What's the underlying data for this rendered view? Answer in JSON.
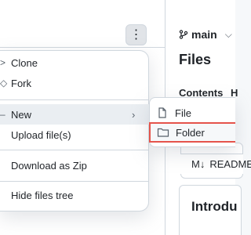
{
  "header": {
    "branch": "main",
    "files_title": "Files",
    "tabs": [
      "Contents",
      "H"
    ]
  },
  "menu": {
    "items": [
      {
        "label": "Clone",
        "icon": "clone-icon"
      },
      {
        "label": "Fork",
        "icon": "fork-icon"
      },
      {
        "label": "New",
        "icon": "plus-icon"
      },
      {
        "label": "Upload file(s)"
      },
      {
        "label": "Download as Zip"
      },
      {
        "label": "Hide files tree"
      }
    ]
  },
  "submenu": {
    "items": [
      {
        "label": "File",
        "icon": "file-icon"
      },
      {
        "label": "Folder",
        "icon": "folder-icon"
      }
    ]
  },
  "readme": {
    "label": "README",
    "prefix": "M↓"
  },
  "intro": {
    "title": "Introdu"
  },
  "colors": {
    "highlight_border": "#e5534b",
    "accent": "#fd8c73"
  }
}
